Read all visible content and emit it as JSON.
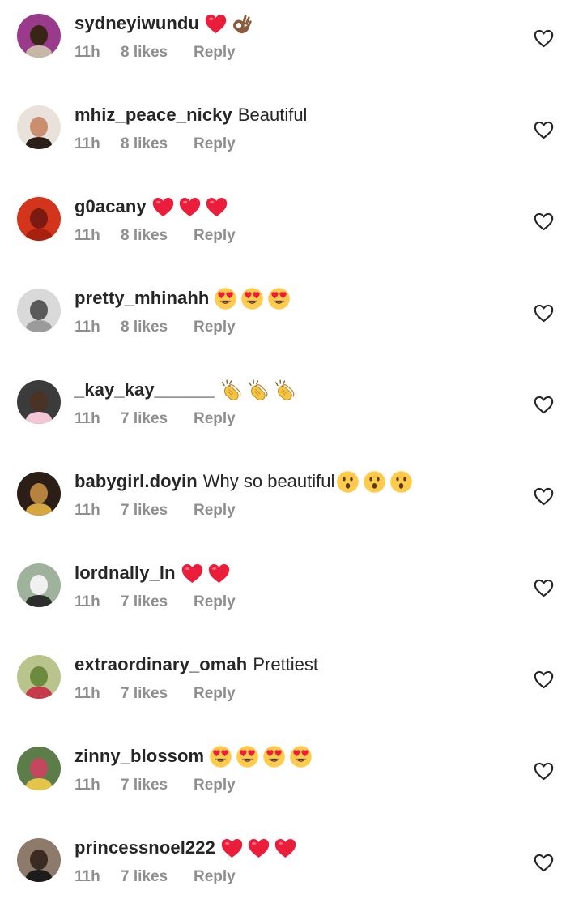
{
  "comments": [
    {
      "username": "sydneyiwundu",
      "text": "",
      "emojis": [
        "red-heart",
        "ok-hand-brown"
      ],
      "time": "11h",
      "likes": "8 likes",
      "reply": "Reply",
      "avatar": {
        "bg": "#9a3a8a",
        "face": "#3a2418",
        "body": "#c8b6a8"
      }
    },
    {
      "username": "mhiz_peace_nicky",
      "text": "Beautiful",
      "emojis": [],
      "time": "11h",
      "likes": "8 likes",
      "reply": "Reply",
      "avatar": {
        "bg": "#e9e2da",
        "face": "#c98f6f",
        "body": "#2b1f1a"
      }
    },
    {
      "username": "g0acany",
      "text": "",
      "emojis": [
        "red-heart",
        "red-heart",
        "red-heart"
      ],
      "time": "11h",
      "likes": "8 likes",
      "reply": "Reply",
      "avatar": {
        "bg": "#d3341c",
        "face": "#7a1a10",
        "body": "#a8200e"
      }
    },
    {
      "username": "pretty_mhinahh",
      "text": "",
      "emojis": [
        "heart-eyes",
        "heart-eyes",
        "heart-eyes"
      ],
      "time": "11h",
      "likes": "8 likes",
      "reply": "Reply",
      "avatar": {
        "bg": "#d9d9d9",
        "face": "#5a5a5a",
        "body": "#9b9b9b"
      }
    },
    {
      "username": "_kay_kay______",
      "text": "",
      "emojis": [
        "clap",
        "clap",
        "clap"
      ],
      "time": "11h",
      "likes": "7 likes",
      "reply": "Reply",
      "avatar": {
        "bg": "#3b3b3b",
        "face": "#4a3325",
        "body": "#f3c7d6"
      }
    },
    {
      "username": "babygirl.doyin",
      "text": "Why so beautiful",
      "emojis": [
        "astonished",
        "astonished",
        "astonished"
      ],
      "time": "11h",
      "likes": "7 likes",
      "reply": "Reply",
      "avatar": {
        "bg": "#2a1e16",
        "face": "#b5833e",
        "body": "#d6a640"
      }
    },
    {
      "username": "lordnally_ln",
      "text": "",
      "emojis": [
        "red-heart",
        "red-heart"
      ],
      "time": "11h",
      "likes": "7 likes",
      "reply": "Reply",
      "avatar": {
        "bg": "#9fb29b",
        "face": "#f0f0f0",
        "body": "#2e2e2e"
      }
    },
    {
      "username": "extraordinary_omah",
      "text": "Prettiest",
      "emojis": [],
      "time": "11h",
      "likes": "7 likes",
      "reply": "Reply",
      "avatar": {
        "bg": "#b9c48d",
        "face": "#6d8b3e",
        "body": "#c73a4a"
      }
    },
    {
      "username": "zinny_blossom",
      "text": "",
      "emojis": [
        "heart-eyes",
        "heart-eyes",
        "heart-eyes",
        "heart-eyes"
      ],
      "time": "11h",
      "likes": "7 likes",
      "reply": "Reply",
      "avatar": {
        "bg": "#5c7d4a",
        "face": "#c2485e",
        "body": "#e6c34b"
      }
    },
    {
      "username": "princessnoel222",
      "text": "",
      "emojis": [
        "red-heart",
        "red-heart",
        "red-heart"
      ],
      "time": "11h",
      "likes": "7 likes",
      "reply": "Reply",
      "avatar": {
        "bg": "#8d7a6a",
        "face": "#3b2a22",
        "body": "#1c1c1c"
      }
    }
  ],
  "colors": {
    "text": "#262626",
    "meta": "#8e8e8e",
    "heart_outline": "#262626",
    "emoji_red": "#ea1d3b",
    "emoji_yellow": "#ffcb4c",
    "emoji_clap": "#f5c541",
    "ok_hand_skin": "#8a5a3c"
  },
  "icons": {
    "like_button": "heart-outline-icon"
  }
}
